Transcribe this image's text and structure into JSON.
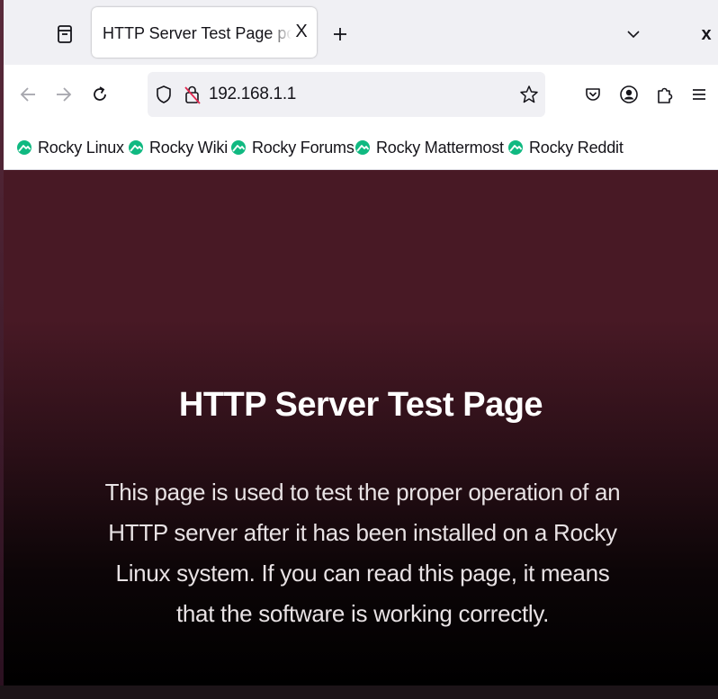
{
  "tab": {
    "title": "HTTP Server Test Page powered by Rocky Linux",
    "close_glyph": "X"
  },
  "window": {
    "close_glyph": "x"
  },
  "navbar": {
    "url": "192.168.1.1"
  },
  "bookmarks": [
    {
      "label": "Rocky Linux",
      "icon": "rocky-logo-icon"
    },
    {
      "label": "Rocky Wiki",
      "icon": "rocky-logo-icon"
    },
    {
      "label": "Rocky Forums",
      "icon": "rocky-logo-icon"
    },
    {
      "label": "Rocky Mattermost",
      "icon": "rocky-logo-icon"
    },
    {
      "label": "Rocky Reddit",
      "icon": "rocky-logo-icon"
    }
  ],
  "page": {
    "heading": "HTTP Server Test Page",
    "body": "This page is used to test the proper operation of an HTTP server after it has been installed on a Rocky Linux system. If you can read this page, it means that the software is working correctly."
  },
  "colors": {
    "rocky_green": "#10b981",
    "page_top": "#481925",
    "page_bottom": "#000000"
  }
}
